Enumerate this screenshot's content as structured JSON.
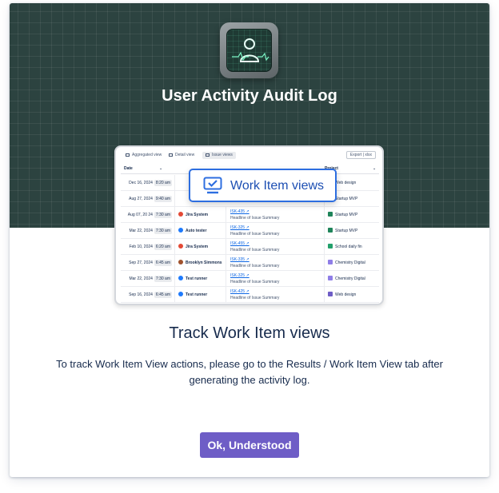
{
  "header": {
    "title": "User Activity Audit Log",
    "logo_icon": "monitor-user-pulse-icon"
  },
  "preview": {
    "tabs": [
      {
        "label": "Aggregated view",
        "active": false
      },
      {
        "label": "Detail view",
        "active": false
      },
      {
        "label": "Issue views",
        "active": true
      }
    ],
    "export_label": "Export | xlsx",
    "columns": [
      "Date",
      "Project"
    ],
    "rows": [
      {
        "date": "Dec 16, 2024",
        "time": "8:20 am",
        "user": "",
        "key": "",
        "summary": "",
        "project": "Web design",
        "user_color": "",
        "project_color": ""
      },
      {
        "date": "Aug 27, 2024",
        "time": "9:40 am",
        "user": "",
        "key": "",
        "summary": "",
        "project": "Startup MVP",
        "user_color": "",
        "project_color": ""
      },
      {
        "date": "Aug 07, 20 24",
        "time": "7:30 am",
        "user": "Jira System",
        "key": "ISK-435",
        "summary": "Headline of Issue Summary",
        "project": "Startup MVP",
        "user_color": "#e34935",
        "project_color": "#1f845a"
      },
      {
        "date": "Mar 22, 2024",
        "time": "7:30 am",
        "user": "Auto tester",
        "key": "ISK-325",
        "summary": "Headline of Issue Summary",
        "project": "Startup MVP",
        "user_color": "#1d7afc",
        "project_color": "#1f845a"
      },
      {
        "date": "Feb 10, 2024",
        "time": "6:20 am",
        "user": "Jira System",
        "key": "ISK-455",
        "summary": "Headline of Issue Summary",
        "project": "School daily fin",
        "user_color": "#e34935",
        "project_color": "#22a06b"
      },
      {
        "date": "Sep 27, 2024",
        "time": "6:45 am",
        "user": "Brooklyn Simmons",
        "key": "ISK-335",
        "summary": "Headline of Issue Summary",
        "project": "Chemistry Digital",
        "user_color": "#a0522d",
        "project_color": "#8f7ee7"
      },
      {
        "date": "Mar 22, 2024",
        "time": "7:30 am",
        "user": "Test runner",
        "key": "ISK-325",
        "summary": "Headline of Issue Summary",
        "project": "Chemistry Digital",
        "user_color": "#1d7afc",
        "project_color": "#8f7ee7"
      },
      {
        "date": "Sep 16, 2024",
        "time": "6:45 am",
        "user": "Test runner",
        "key": "ISK-425",
        "summary": "Headline of Issue Summary",
        "project": "Web design",
        "user_color": "#1d7afc",
        "project_color": "#6e5dc6"
      }
    ]
  },
  "badge": {
    "label": "Work Item views",
    "icon": "monitor-check-icon",
    "color": "#2d6ee0"
  },
  "content": {
    "title": "Track Work Item views",
    "description": "To track Work Item View actions, please go to the Results / Work Item View tab after generating the activity log."
  },
  "actions": {
    "ok_label": "Ok, Understood",
    "ok_color": "#6e5dc6"
  }
}
